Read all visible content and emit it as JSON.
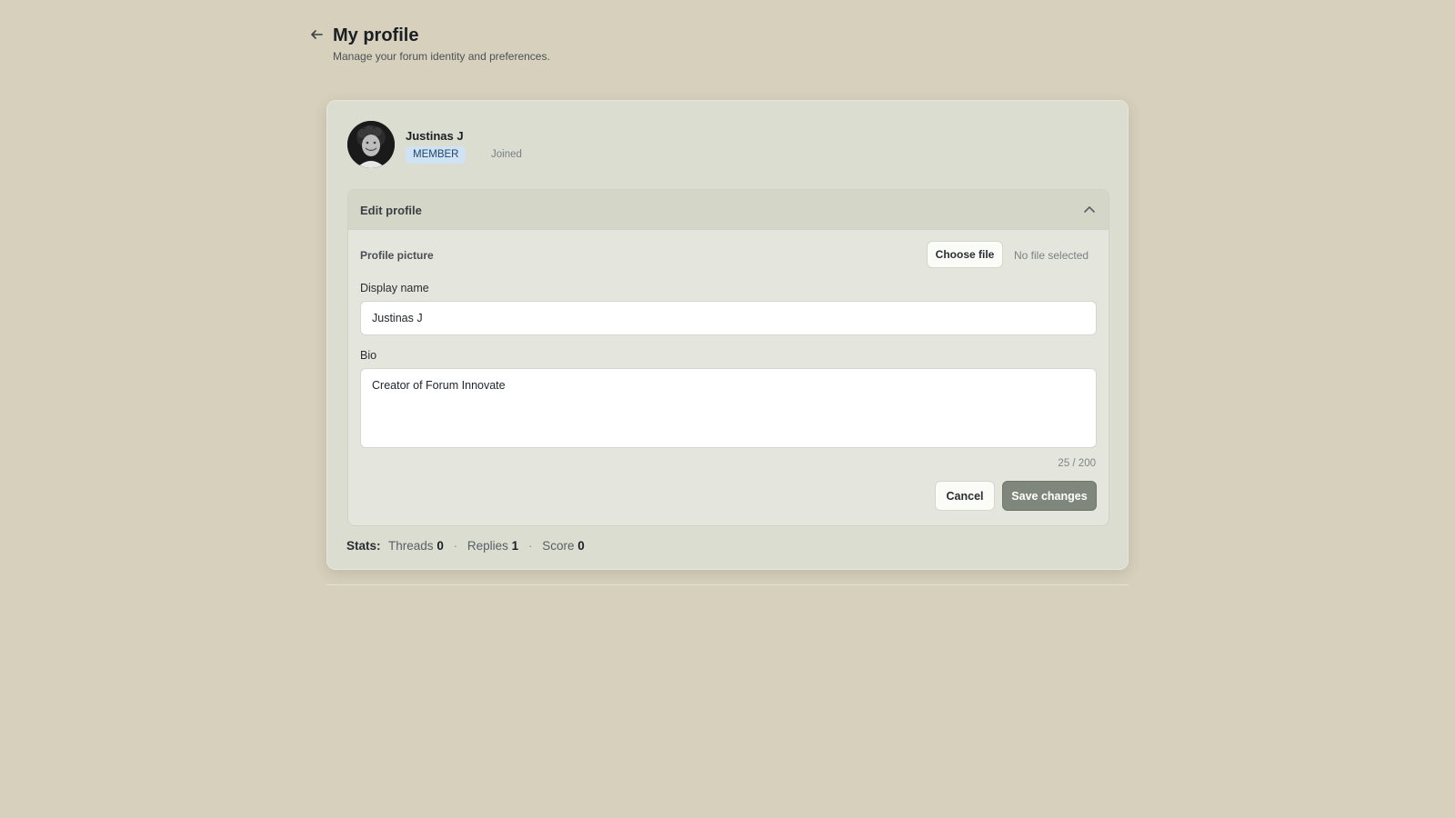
{
  "header": {
    "title": "My profile",
    "subtitle": "Manage your forum identity and preferences."
  },
  "user": {
    "name": "Justinas J",
    "role": "MEMBER",
    "joined_label": "Joined"
  },
  "edit_panel": {
    "title": "Edit profile",
    "expanded": true,
    "profile_picture_label": "Profile picture",
    "choose_file_label": "Choose file",
    "file_status": "No file selected",
    "display_name_label": "Display name",
    "display_name_value": "Justinas J",
    "bio_label": "Bio",
    "bio_value": "Creator of Forum Innovate",
    "char_count": "25 / 200",
    "cancel_label": "Cancel",
    "save_label": "Save changes"
  },
  "stats": {
    "label": "Stats:",
    "threads_label": "Threads",
    "threads_value": "0",
    "replies_label": "Replies",
    "replies_value": "1",
    "score_label": "Score",
    "score_value": "0"
  },
  "colors": {
    "background": "#d6d0bc",
    "card": "#dbddd1",
    "badge_bg": "#cfe3f4",
    "save_button": "#7f877c"
  }
}
